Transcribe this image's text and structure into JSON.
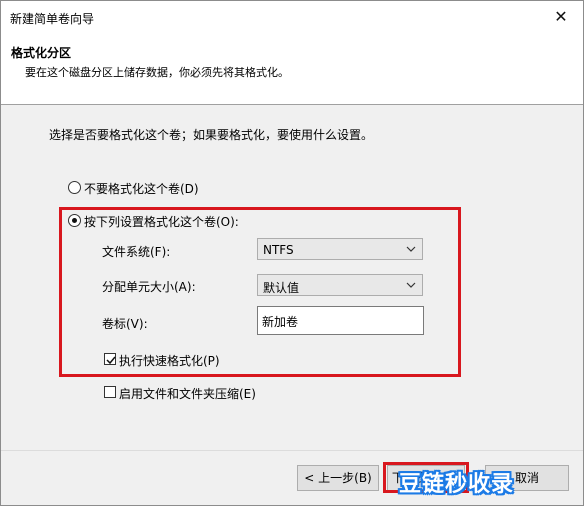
{
  "window": {
    "title": "新建简单卷向导",
    "close_symbol": "✕"
  },
  "header": {
    "title": "格式化分区",
    "subtitle": "要在这个磁盘分区上储存数据，你必须先将其格式化。"
  },
  "main": {
    "intro": "选择是否要格式化这个卷；如果要格式化，要使用什么设置。",
    "option_no_format": {
      "label": "不要格式化这个卷(D)",
      "checked": false
    },
    "option_format": {
      "label": "按下列设置格式化这个卷(O):",
      "checked": true
    },
    "filesystem": {
      "label": "文件系统(F):",
      "value": "NTFS"
    },
    "allocation": {
      "label": "分配单元大小(A):",
      "value": "默认值"
    },
    "volume_label": {
      "label": "卷标(V):",
      "value": "新加卷"
    },
    "quick_format": {
      "label": "执行快速格式化(P)",
      "checked": true
    },
    "compression": {
      "label": "启用文件和文件夹压缩(E)",
      "checked": false
    }
  },
  "footer": {
    "back_label": "< 上一步(B)",
    "next_label": "下一步(N) >",
    "cancel_label": "取消"
  },
  "watermark": "豆链秒收录",
  "colors": {
    "highlight": "#d8171e",
    "watermark": "#1c7be6"
  }
}
